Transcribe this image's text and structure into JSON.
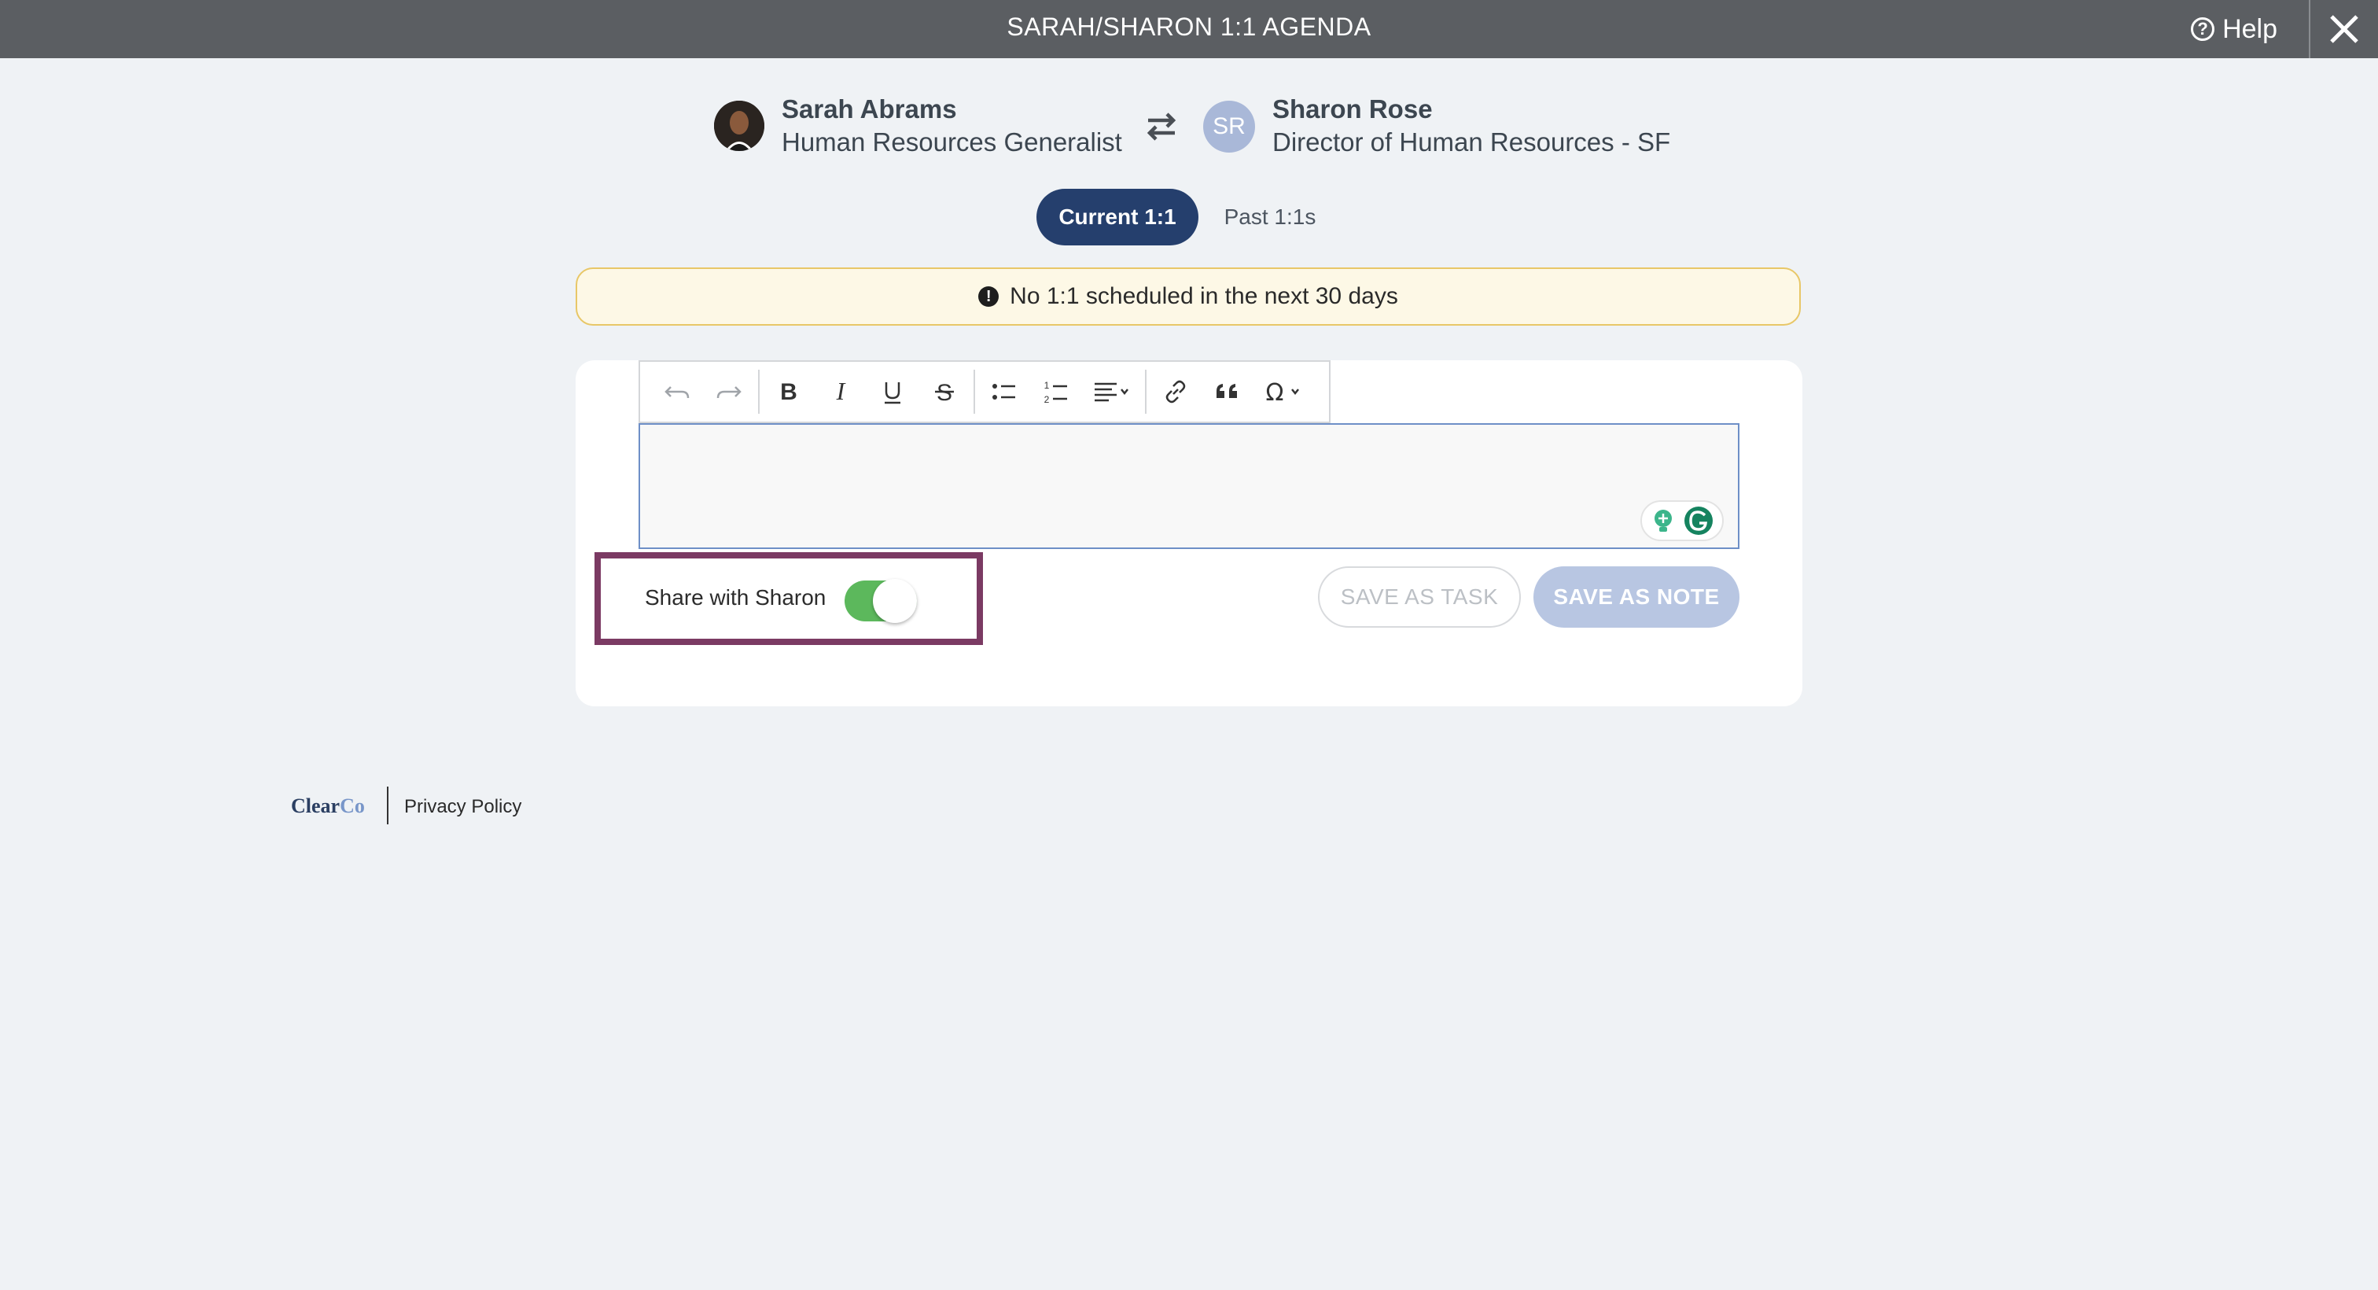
{
  "window": {
    "title": "SARAH/SHARON 1:1 AGENDA",
    "help_label": "Help"
  },
  "participants": {
    "left": {
      "name": "Sarah Abrams",
      "role": "Human Resources Generalist"
    },
    "right": {
      "name": "Sharon Rose",
      "role": "Director of Human Resources - SF",
      "initials": "SR"
    }
  },
  "tabs": {
    "current": "Current 1:1",
    "past": "Past 1:1s"
  },
  "alert": {
    "icon": "exclamation-icon",
    "text": "No 1:1 scheduled in the next 30 days"
  },
  "editor": {
    "toolbar": [
      "undo-icon",
      "redo-icon",
      "bold-icon",
      "italic-icon",
      "underline-icon",
      "strikethrough-icon",
      "bulleted-list-icon",
      "numbered-list-icon",
      "align-icon",
      "link-icon",
      "blockquote-icon",
      "special-characters-icon"
    ],
    "value": ""
  },
  "share": {
    "label": "Share with Sharon",
    "enabled": true
  },
  "actions": {
    "save_task": "SAVE AS TASK",
    "save_note": "SAVE AS NOTE"
  },
  "footer": {
    "logo_main": "Clear",
    "logo_accent": "Co",
    "privacy": "Privacy Policy"
  },
  "colors": {
    "header": "#5b5e62",
    "tab_active": "#253f6d",
    "alert_bg": "#fdf8e6",
    "alert_border": "#e8c767",
    "toggle_on": "#5cb85c",
    "highlight_border": "#7b3a63",
    "save_note_disabled": "#b8c6e2"
  }
}
